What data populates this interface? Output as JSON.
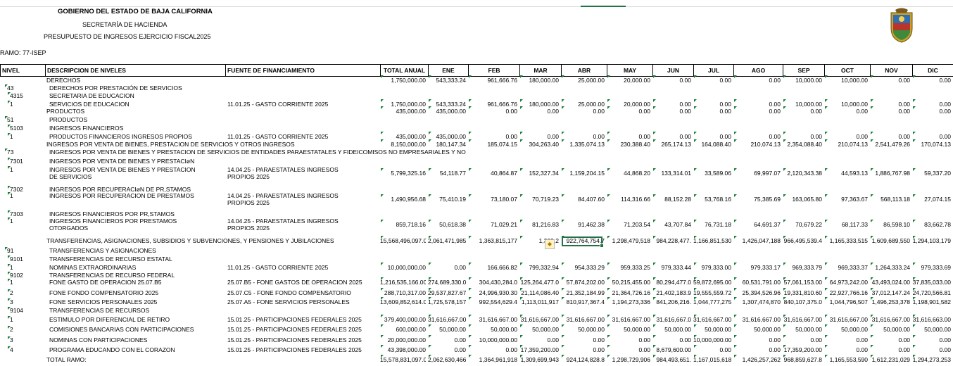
{
  "header": {
    "title": "GOBIERNO DEL ESTADO DE BAJA CALIFORNIA",
    "secretaria": "SECRETARÍA DE HACIENDA",
    "presupuesto": "PRESUPUESTO DE INGRESOS EJERCICIO FISCAL2025",
    "ramo": "RAMO: 77-ISEP"
  },
  "columns": [
    "NIVEL",
    "DESCRIPCION DE NIVELES",
    "FUENTE DE FINANCIAMIENTO",
    "TOTAL ANUAL",
    "ENE",
    "FEB",
    "MAR",
    "ABR",
    "MAY",
    "JUN",
    "JUL",
    "AGO",
    "SEP",
    "OCT",
    "NOV",
    "DIC"
  ],
  "rows": [
    {
      "lvl": "",
      "d": [
        "DERECHOS"
      ],
      "f": [],
      "v": [
        "1,750,000.00",
        "543,333.24",
        "961,666.76",
        "180,000.00",
        "25,000.00",
        "20,000.00",
        "0.00",
        "0.00",
        "0.00",
        "10,000.00",
        "10,000.00",
        "0.00",
        "0.00"
      ]
    },
    {
      "lvl": "43",
      "d": [
        "DERECHOS POR PRESTACIÓN DE SERVICIOS"
      ],
      "f": [],
      "v": []
    },
    {
      "lvl": "4315",
      "d": [
        "SECRETARIA DE EDUCACION"
      ],
      "f": [],
      "v": []
    },
    {
      "lvl": "1",
      "d": [
        "SERVICIOS DE EDUCACION"
      ],
      "f": [
        "11.01.25 - GASTO CORRIENTE 2025"
      ],
      "v": [
        "1,750,000.00",
        "543,333.24",
        "961,666.76",
        "180,000.00",
        "25,000.00",
        "20,000.00",
        "0.00",
        "0.00",
        "0.00",
        "10,000.00",
        "10,000.00",
        "0.00",
        "0.00"
      ]
    },
    {
      "lvl": "",
      "d": [
        "PRODUCTOS"
      ],
      "f": [],
      "v": [
        "435,000.00",
        "435,000.00",
        "0.00",
        "0.00",
        "0.00",
        "0.00",
        "0.00",
        "0.00",
        "0.00",
        "0.00",
        "0.00",
        "0.00",
        "0.00"
      ]
    },
    {
      "lvl": "51",
      "d": [
        "PRODUCTOS"
      ],
      "f": [],
      "v": []
    },
    {
      "lvl": "5103",
      "d": [
        "INGRESOS FINANCIEROS"
      ],
      "f": [],
      "v": []
    },
    {
      "lvl": "1",
      "d": [
        "PRODUCTOS FINANCIEROS INGRESOS PROPIOS"
      ],
      "f": [
        "11.01.25 - GASTO CORRIENTE 2025"
      ],
      "v": [
        "435,000.00",
        "435,000.00",
        "0.00",
        "0.00",
        "0.00",
        "0.00",
        "0.00",
        "0.00",
        "0.00",
        "0.00",
        "0.00",
        "0.00",
        "0.00"
      ]
    },
    {
      "lvl": "",
      "d": [
        "INGRESOS POR VENTA DE BIENES, PRESTACION DE SERVICIOS Y OTROS INGRESOS"
      ],
      "f": [],
      "v": [
        "8,150,000.00",
        "180,147.34",
        "185,074.15",
        "304,263.40",
        "1,335,074.13",
        "230,388.40",
        "265,174.13",
        "164,088.40",
        "210,074.13",
        "2,354,088.40",
        "210,074.13",
        "2,541,479.26",
        "170,074.13"
      ]
    },
    {
      "lvl": "73",
      "d": [
        "INGRESOS POR VENTA DE BIENES Y PRESTACION DE SERVICIOS DE ENTIDADES PARAESTATALES Y FIDEICOMISOS NO EMPRESARIALES Y NO"
      ],
      "f": [],
      "v": []
    },
    {
      "lvl": "7301",
      "d": [
        "INGRESOS POR VENTA DE BIENES Y PRESTACIøN"
      ],
      "f": [],
      "v": []
    },
    {
      "lvl": "1",
      "d": [
        "INGRESOS POR VENTA DE BIENES Y PRESTACION",
        "DE SERVICIOS"
      ],
      "f": [
        "14.04.25 - PARAESTATALES INGRESOS",
        "PROPIOS 2025"
      ],
      "v": [
        "5,799,325.16",
        "54,118.77",
        "40,864.87",
        "152,327.34",
        "1,159,204.15",
        "44,868.20",
        "133,314.01",
        "33,589.06",
        "69,997.07",
        "2,120,343.38",
        "44,593.13",
        "1,886,767.98",
        "59,337.20"
      ]
    },
    {
      "lvl": "7302",
      "d": [
        "INGRESOS POR RECUPERACIøN DE PR,STAMOS"
      ],
      "f": [],
      "v": []
    },
    {
      "lvl": "1",
      "d": [
        "INGRESOS POR RECUPERACION DE PRESTAMOS"
      ],
      "f": [
        "14.04.25 - PARAESTATALES INGRESOS",
        "PROPIOS 2025"
      ],
      "v": [
        "1,490,956.68",
        "75,410.19",
        "73,180.07",
        "70,719.23",
        "84,407.60",
        "114,316.66",
        "88,152.28",
        "53,768.16",
        "75,385.69",
        "163,065.80",
        "97,363.67",
        "568,113.18",
        "27,074.15"
      ]
    },
    {
      "lvl": "7303",
      "d": [
        "INGRESOS FINANCIEROS POR PR,STAMOS"
      ],
      "f": [],
      "v": []
    },
    {
      "lvl": "1",
      "d": [
        "INGRESOS FINANCIEROS POR PRESTAMOS",
        "OTORGADOS"
      ],
      "f": [
        "14.04.25 - PARAESTATALES INGRESOS",
        "PROPIOS 2025"
      ],
      "v": [
        "859,718.16",
        "50,618.38",
        "71,029.21",
        "81,216.83",
        "91,462.38",
        "71,203.54",
        "43,707.84",
        "76,731.18",
        "64,691.37",
        "70,679.22",
        "68,117.33",
        "86,598.10",
        "83,662.78"
      ]
    },
    {
      "lvl": "",
      "d": [
        "TRANSFERENCIAS, ASIGNACIONES, SUBSIDIOS Y SUBVENCIONES, Y PENSIONES Y JUBILACIONES"
      ],
      "f": [],
      "v": [
        "15,568,496,097.00",
        "2,061,471,985",
        "1,363,815,177",
        "1,309,2",
        "922,764,754.7",
        "1,298,479,518",
        "984,228,477.",
        "1,166,851,530",
        "1,426,047,188",
        "966,495,539.4",
        "1,165,333,515",
        "1,609,689,550",
        "1,294,103,179"
      ]
    },
    {
      "lvl": "91",
      "d": [
        "TRANSFERENCIAS Y ASIGNACIONES"
      ],
      "f": [],
      "v": []
    },
    {
      "lvl": "9101",
      "d": [
        "TRANSFERENCIAS DE RECURSO ESTATAL"
      ],
      "f": [],
      "v": []
    },
    {
      "lvl": "1",
      "d": [
        "NOMINAS EXTRAORDINARIAS"
      ],
      "f": [
        "11.01.25 - GASTO CORRIENTE 2025"
      ],
      "v": [
        "10,000,000.00",
        "0.00",
        "166,666.82",
        "799,332.94",
        "954,333.29",
        "959,333.25",
        "979,333.44",
        "979,333.00",
        "979,333.17",
        "969,333.79",
        "969,333.37",
        "1,264,333.24",
        "979,333.69"
      ]
    },
    {
      "lvl": "9102",
      "d": [
        "TRANSFERENCIAS DE RECURSO FEDERAL"
      ],
      "f": [],
      "v": []
    },
    {
      "lvl": "1",
      "d": [
        "FONE GASTO DE OPERACION 25.07.B5"
      ],
      "f": [
        "25.07.B5 - FONE GASTOS DE OPERACION 2025"
      ],
      "v": [
        "1,216,535,166.00",
        "274,689,330.0",
        "304,430,284.0",
        "125,264,477.0",
        "57,874,202.00",
        "50,215,455.00",
        "80,294,477.0",
        "59,872,695.00",
        "60,531,791.00",
        "57,061,153.00",
        "64,973,242.00",
        "43,493,024.00",
        "37,835,033.00"
      ]
    },
    {
      "lvl": "2",
      "d": [
        "FONE FONDO COMPENSATORIO 2025"
      ],
      "f": [
        "25.07.C5 - FONE FONDO COMPENSATORIO"
      ],
      "v": [
        "288,710,317.00",
        "29,537,827.67",
        "24,996,930.30",
        "21,114,086.40",
        "21,352,184.99",
        "21,364,726.16",
        "21,402,183.9",
        "19,555,559.72",
        "25,394,526.96",
        "19,331,810.60",
        "22,927,766.16",
        "37,012,147.24",
        "24,720,566.81"
      ]
    },
    {
      "lvl": "3",
      "d": [
        "FONE SERVICIOS PERSONALES 2025"
      ],
      "f": [
        "25.07.A5 - FONE SERVICIOS PERSONALES"
      ],
      "v": [
        "13,609,852,614.00",
        "1,725,578,157",
        "992,554,629.4",
        "1,113,011,917",
        "810,917,367.4",
        "1,194,273,336",
        "841,206,216.",
        "1,044,777,275",
        "1,307,474,870",
        "840,107,375.0",
        "1,044,796,507",
        "1,496,253,378",
        "1,198,901,582"
      ]
    },
    {
      "lvl": "9104",
      "d": [
        "TRANSFERENCIAS DE RECURSOS"
      ],
      "f": [],
      "v": []
    },
    {
      "lvl": "1",
      "d": [
        "ESTIMULO POR DIFERENCIAL DE RETIRO"
      ],
      "f": [
        "15.01.25 - PARTICIPACIONES FEDERALES 2025"
      ],
      "v": [
        "379,400,000.00",
        "31,616,667.00",
        "31,616,667.00",
        "31,616,667.00",
        "31,616,667.00",
        "31,616,667.00",
        "31,616,667.0",
        "31,616,667.00",
        "31,616,667.00",
        "31,616,667.00",
        "31,616,667.00",
        "31,616,667.00",
        "31,616,663.00"
      ]
    },
    {
      "lvl": "2",
      "d": [
        "COMISIONES BANCARIAS CON PARTICIPACIONES"
      ],
      "f": [
        "15.01.25 - PARTICIPACIONES FEDERALES 2025"
      ],
      "v": [
        "600,000.00",
        "50,000.00",
        "50,000.00",
        "50,000.00",
        "50,000.00",
        "50,000.00",
        "50,000.00",
        "50,000.00",
        "50,000.00",
        "50,000.00",
        "50,000.00",
        "50,000.00",
        "50,000.00"
      ]
    },
    {
      "lvl": "3",
      "d": [
        "NOMINAS CON PARTICIPACIONES"
      ],
      "f": [
        "15.01.25 - PARTICIPACIONES FEDERALES 2025"
      ],
      "v": [
        "20,000,000.00",
        "0.00",
        "10,000,000.00",
        "0.00",
        "0.00",
        "0.00",
        "0.00",
        "10,000,000.00",
        "0.00",
        "0.00",
        "0.00",
        "0.00",
        "0.00"
      ]
    },
    {
      "lvl": "4",
      "d": [
        "PROGRAMA EDUCANDO CON EL CORAZON"
      ],
      "f": [
        "15.01.25 - PARTICIPACIONES FEDERALES 2025"
      ],
      "v": [
        "43,398,000.00",
        "0.00",
        "0.00",
        "17,359,200.00",
        "0.00",
        "0.00",
        "8,679,600.00",
        "0.00",
        "0.00",
        "17,359,200.00",
        "0.00",
        "0.00",
        "0.00"
      ]
    },
    {
      "lvl": "",
      "d": [
        "TOTAL RAMO:"
      ],
      "f": [],
      "v": [
        "15,578,831,097.00",
        "2,062,630,466",
        "1,364,961,918",
        "1,309,699,943",
        "924,124,828.8",
        "1,298,729,906",
        "984,493,651.",
        "1,167,015,618",
        "1,426,257,262",
        "968,859,627.8",
        "1,165,553,590",
        "1,612,231,029",
        "1,294,273,253"
      ]
    }
  ]
}
